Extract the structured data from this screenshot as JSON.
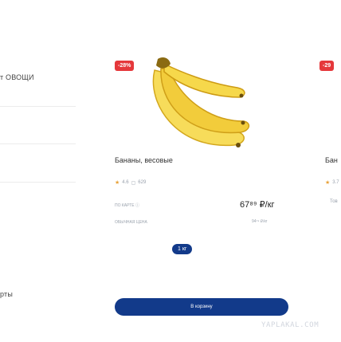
{
  "sidebar": {
    "items": [
      {
        "label": "т ОВОЩИ"
      },
      {
        "label": "рты"
      }
    ]
  },
  "product_main": {
    "discount_badge": "-28%",
    "name": "Бананы, весовые",
    "rating": "4.6",
    "reviews": "629",
    "card_price_label": "ПО КАРТЕ",
    "card_price": "67⁸⁹ ₽/кг",
    "regular_price_label": "ОБЫЧНАЯ ЦЕНА",
    "regular_price": "94⁷⁹ ₽/кг",
    "unit_chip": "1 кг",
    "cart_button": "В корзину"
  },
  "product_next": {
    "discount_badge": "-29",
    "name": "Бан",
    "rating": "3.7",
    "price_label": "Тов"
  },
  "watermark": "YAPLAKAL.COM",
  "colors": {
    "accent": "#123a8a",
    "discount": "#e5383b",
    "star": "#e8a23a"
  }
}
